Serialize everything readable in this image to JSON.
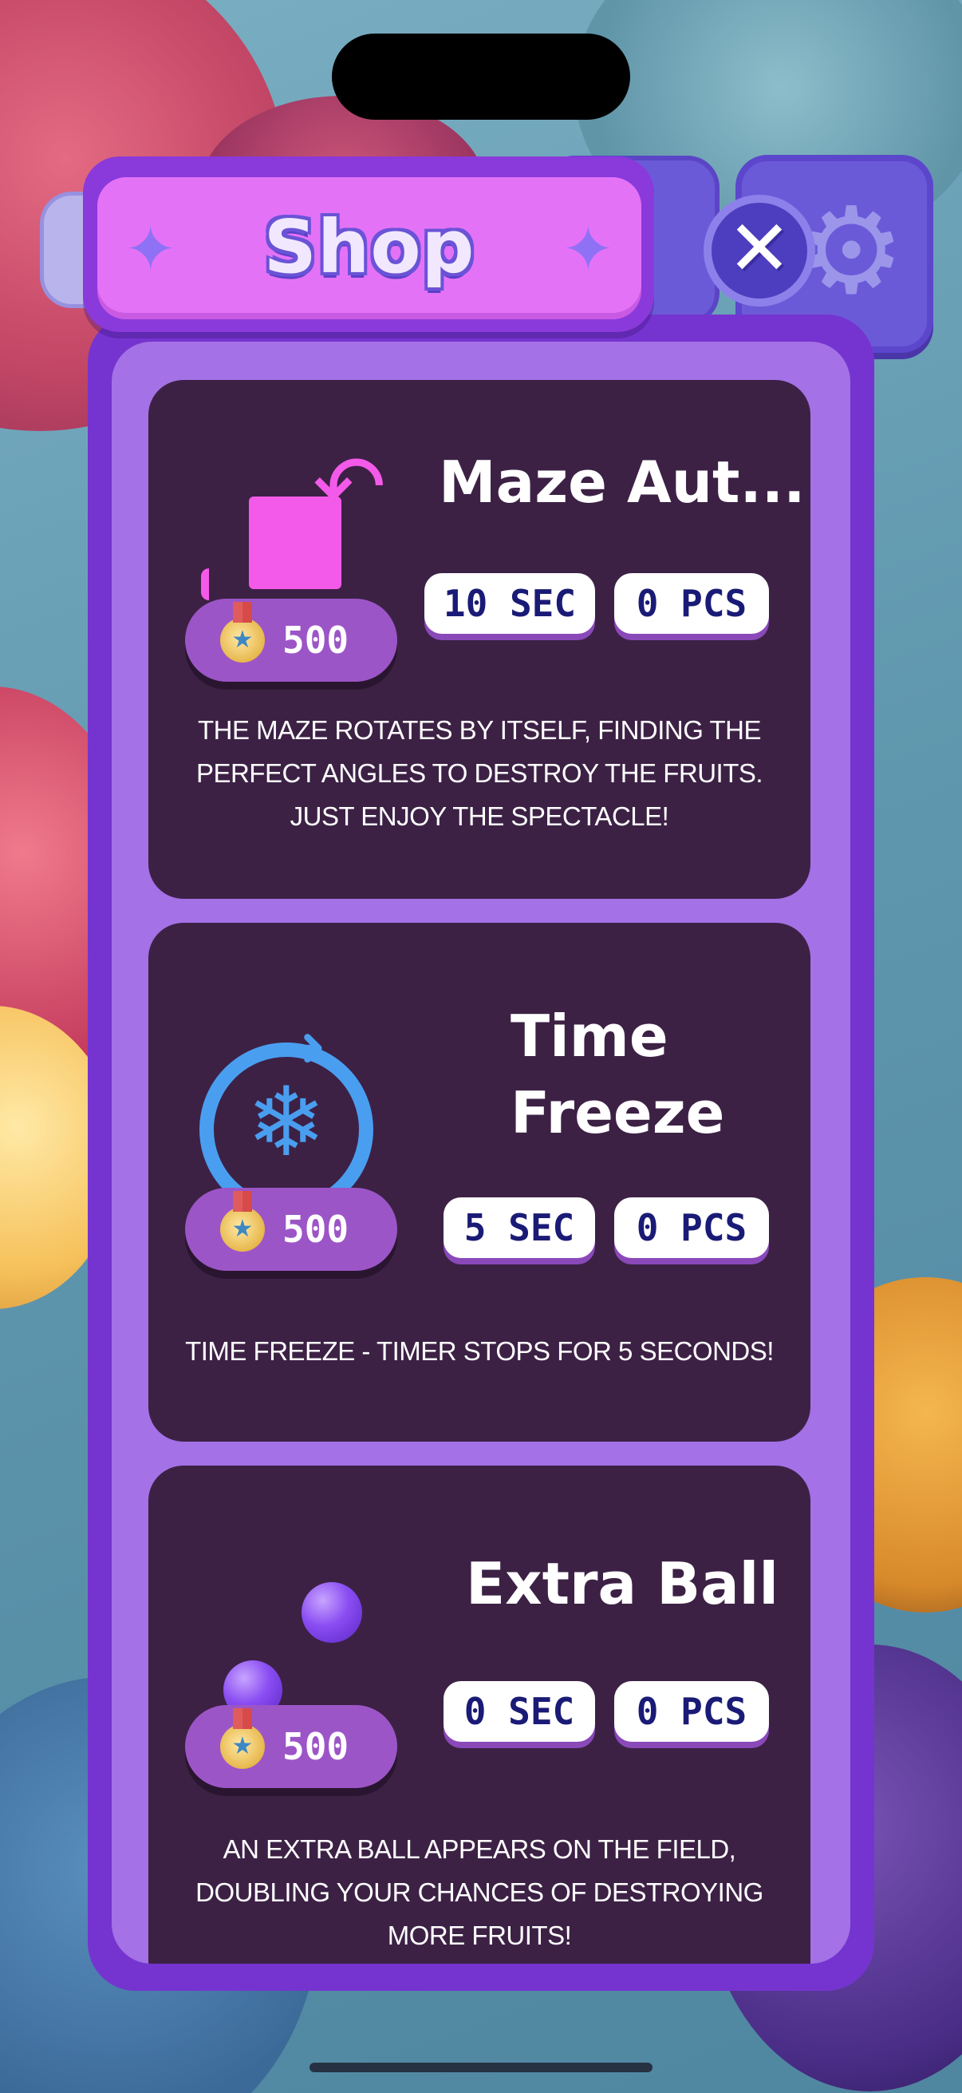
{
  "screen": {
    "title": "Shop",
    "close_label": "✕",
    "gear_icon": "⚙",
    "sparkle": "✦"
  },
  "items": [
    {
      "title": "Maze Aut...",
      "duration": "10 SEC",
      "quantity": "0 PCS",
      "price": "500",
      "description": "THE MAZE ROTATES BY ITSELF, FINDING THE PERFECT ANGLES TO DESTROY THE FRUITS. JUST ENJOY THE SPECTACLE!",
      "icon": "maze-rotate-icon"
    },
    {
      "title_line1": "Time",
      "title_line2": "Freeze",
      "duration": "5 SEC",
      "quantity": "0 PCS",
      "price": "500",
      "description": "TIME FREEZE - TIMER STOPS FOR 5 SECONDS!",
      "icon": "snowflake-icon"
    },
    {
      "title": "Extra Ball",
      "duration": "0 SEC",
      "quantity": "0 PCS",
      "price": "500",
      "description": "AN EXTRA BALL APPEARS ON THE FIELD, DOUBLING YOUR CHANCES OF DESTROYING MORE FRUITS!",
      "icon": "extra-ball-icon"
    }
  ],
  "colors": {
    "panel": "#7534cf",
    "panel_inner": "#a471e6",
    "card": "#3c2145",
    "title_banner": "#e472f7",
    "chip_text": "#1a1b76",
    "price_pill": "#9c55c7"
  }
}
